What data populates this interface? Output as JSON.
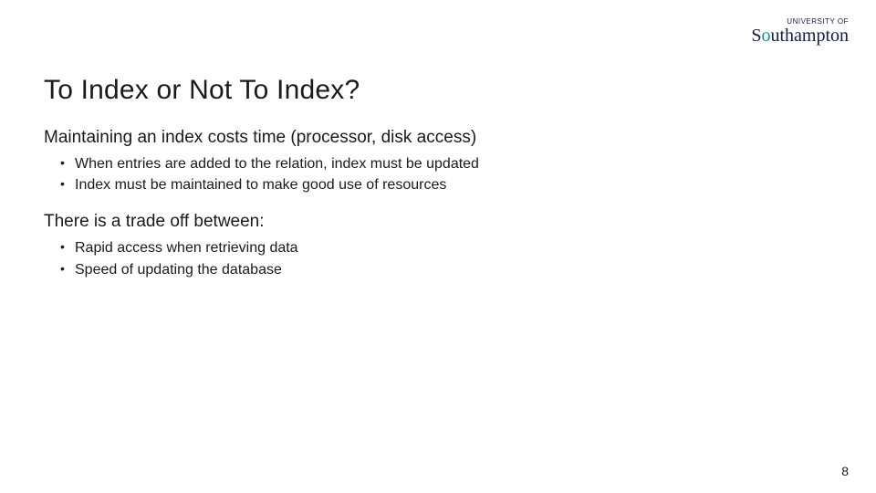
{
  "logo": {
    "top": "UNIVERSITY OF",
    "main_prefix": "S",
    "main_accent": "o",
    "main_suffix": "uthampton"
  },
  "title": "To Index or Not To Index?",
  "section1": {
    "lead": "Maintaining an index costs time (processor, disk access)",
    "bullets": [
      "When entries are added to the relation, index must be updated",
      "Index must be maintained to make good use of resources"
    ]
  },
  "section2": {
    "lead": "There is a trade off between:",
    "bullets": [
      "Rapid access when retrieving data",
      "Speed of updating the database"
    ]
  },
  "page_number": "8"
}
